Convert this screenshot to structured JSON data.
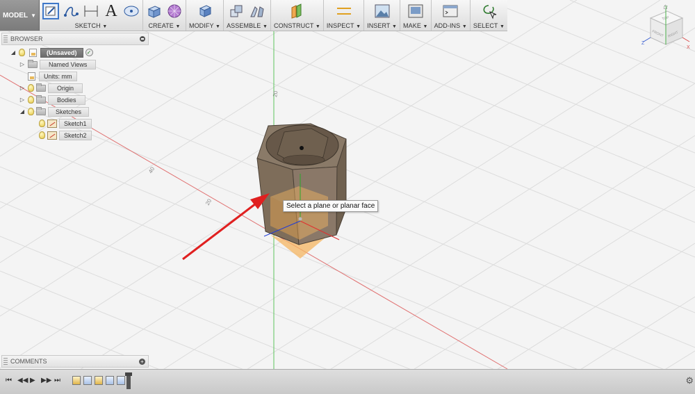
{
  "toolbar": {
    "mode_label": "MODEL",
    "groups": [
      {
        "key": "sketch",
        "label": "SKETCH"
      },
      {
        "key": "create",
        "label": "CREATE"
      },
      {
        "key": "modify",
        "label": "MODIFY"
      },
      {
        "key": "assemble",
        "label": "ASSEMBLE"
      },
      {
        "key": "construct",
        "label": "CONSTRUCT"
      },
      {
        "key": "inspect",
        "label": "INSPECT"
      },
      {
        "key": "insert",
        "label": "INSERT"
      },
      {
        "key": "make",
        "label": "MAKE"
      },
      {
        "key": "addins",
        "label": "ADD-INS"
      },
      {
        "key": "select",
        "label": "SELECT"
      }
    ],
    "sketch_text_tool": "A"
  },
  "browser": {
    "title": "BROWSER",
    "items": [
      {
        "label": "(Unsaved)"
      },
      {
        "label": "Named Views"
      },
      {
        "label": "Units: mm"
      },
      {
        "label": "Origin"
      },
      {
        "label": "Bodies"
      },
      {
        "label": "Sketches"
      },
      {
        "label": "Sketch1"
      },
      {
        "label": "Sketch2"
      }
    ]
  },
  "comments": {
    "title": "COMMENTS"
  },
  "tooltip": {
    "text": "Select a plane or planar face"
  },
  "viewport": {
    "grid_labels": [
      "20",
      "40",
      "20"
    ]
  },
  "viewcube": {
    "faces": [
      "TOP",
      "FRONT",
      "RIGHT"
    ],
    "axes": [
      "Y",
      "Z",
      "X"
    ]
  },
  "colors": {
    "accent_blue": "#4a7fd0",
    "axis_red": "#e07070",
    "axis_green": "#5cc45c",
    "body_brown": "#7a6a58",
    "selection_orange": "#f5b562",
    "arrow_red": "#e02020"
  }
}
